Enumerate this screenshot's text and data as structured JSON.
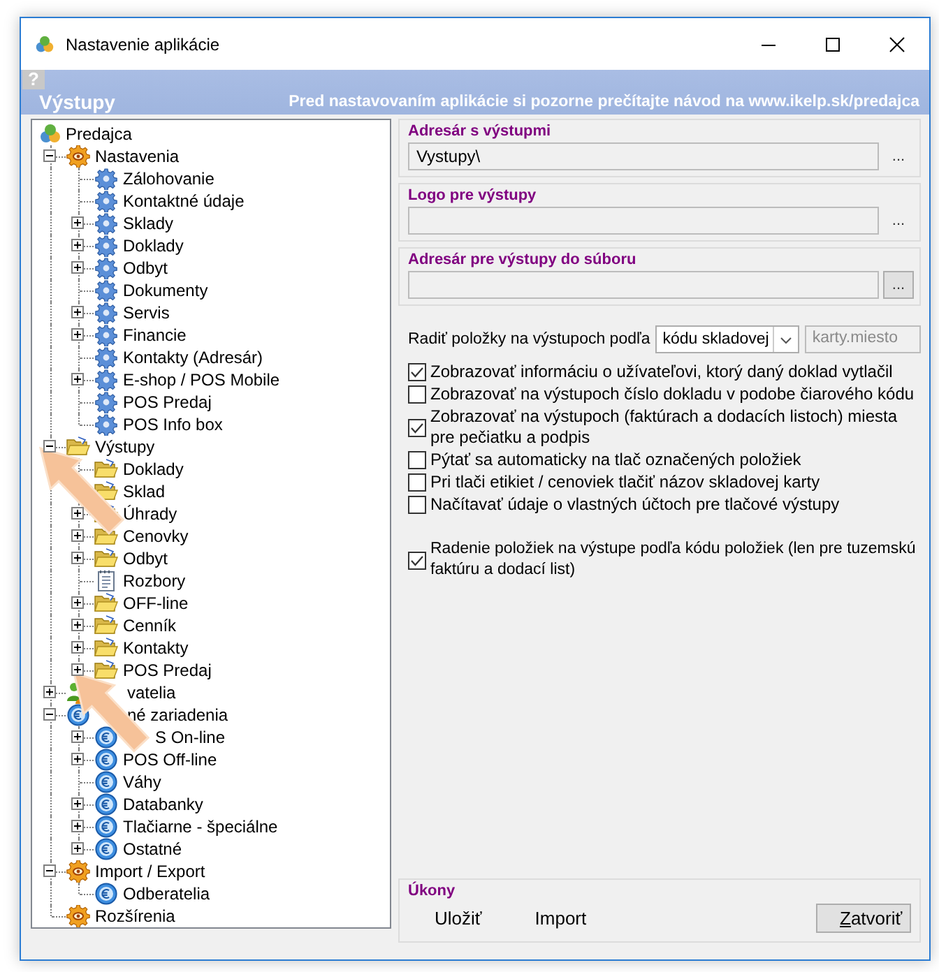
{
  "window": {
    "title": "Nastavenie aplikácie"
  },
  "help_button": "?",
  "header": {
    "title": "Výstupy",
    "notice": "Pred nastavovaním aplikácie si pozorne prečítajte návod na www.ikelp.sk/predajca"
  },
  "tree": {
    "label": "Predajca",
    "kind": "app",
    "children": [
      {
        "label": "Nastavenia",
        "kind": "cog",
        "expanded": true,
        "children": [
          {
            "label": "Zálohovanie",
            "kind": "gear"
          },
          {
            "label": "Kontaktné údaje",
            "kind": "gear"
          },
          {
            "label": "Sklady",
            "kind": "gear",
            "expanded": false
          },
          {
            "label": "Doklady",
            "kind": "gear",
            "expanded": false
          },
          {
            "label": "Odbyt",
            "kind": "gear",
            "expanded": false
          },
          {
            "label": "Dokumenty",
            "kind": "gear"
          },
          {
            "label": "Servis",
            "kind": "gear",
            "expanded": false
          },
          {
            "label": "Financie",
            "kind": "gear",
            "expanded": false
          },
          {
            "label": "Kontakty (Adresár)",
            "kind": "gear"
          },
          {
            "label": "E-shop / POS Mobile",
            "kind": "gear",
            "expanded": false
          },
          {
            "label": "POS Predaj",
            "kind": "gear"
          },
          {
            "label": "POS Info box",
            "kind": "gear"
          }
        ]
      },
      {
        "label": "Výstupy",
        "kind": "folder",
        "expanded": true,
        "children": [
          {
            "label": "Doklady",
            "kind": "folder"
          },
          {
            "label": "Sklad",
            "kind": "folder"
          },
          {
            "label": "Úhrady",
            "kind": "folder",
            "expanded": false
          },
          {
            "label": "Cenovky",
            "kind": "folder",
            "expanded": false
          },
          {
            "label": "Odbyt",
            "kind": "folder",
            "expanded": false
          },
          {
            "label": "Rozbory",
            "kind": "doc"
          },
          {
            "label": "OFF-line",
            "kind": "folder",
            "expanded": false
          },
          {
            "label": "Cenník",
            "kind": "folder",
            "expanded": false
          },
          {
            "label": "Kontakty",
            "kind": "folder",
            "expanded": false
          },
          {
            "label": "POS Predaj",
            "kind": "folder",
            "expanded": false
          }
        ]
      },
      {
        "label": "vatelia",
        "kind": "users",
        "expanded": false,
        "covered": true
      },
      {
        "label": "né zariadenia",
        "kind": "euro",
        "expanded": true,
        "covered": true,
        "children": [
          {
            "label": "S On-line",
            "kind": "euro",
            "expanded": false,
            "covered": true
          },
          {
            "label": "POS Off-line",
            "kind": "euro",
            "expanded": false
          },
          {
            "label": "Váhy",
            "kind": "euro"
          },
          {
            "label": "Databanky",
            "kind": "euro",
            "expanded": false
          },
          {
            "label": "Tlačiarne - špeciálne",
            "kind": "euro",
            "expanded": false
          },
          {
            "label": "Ostatné",
            "kind": "euro",
            "expanded": false
          }
        ]
      },
      {
        "label": "Import / Export",
        "kind": "cog",
        "expanded": true,
        "children": [
          {
            "label": "Odberatelia",
            "kind": "euro"
          }
        ]
      },
      {
        "label": "Rozšírenia",
        "kind": "cog"
      }
    ]
  },
  "path_groups": [
    {
      "legend": "Adresár s výstupmi",
      "value": "Vystupy\\",
      "button": "...",
      "button_framed": false
    },
    {
      "legend": "Logo pre výstupy",
      "button": "...",
      "button_framed": false
    },
    {
      "legend": "Adresár pre výstupy do súboru",
      "button": "...",
      "button_framed": true
    }
  ],
  "sort_by": {
    "label": "Radiť položky na výstupoch podľa",
    "value": "kódu skladovej",
    "extra_value": "karty.miesto"
  },
  "print_options": [
    {
      "label": "Zobrazovať informáciu o užívateľovi, ktorý daný doklad vytlačil",
      "checked": true
    },
    {
      "label": "Zobrazovať na výstupoch číslo dokladu v podobe čiarového kódu",
      "checked": false
    },
    {
      "label": "Zobrazovať na výstupoch (faktúrach a dodacích listoch) miesta pre pečiatku a podpis",
      "checked": true
    },
    {
      "label": "Pýtať sa automaticky na tlač označených položiek",
      "checked": false
    },
    {
      "label": "Pri tlači etikiet / cenoviek tlačiť názov skladovej karty",
      "checked": false
    },
    {
      "label": "Načítavať údaje o vlastných účtoch pre tlačové výstupy",
      "checked": false
    }
  ],
  "item_sorting": {
    "label": "Radenie položiek na výstupe podľa kódu položiek (len pre tuzemskú faktúru a dodací list)",
    "checked": true
  },
  "actions": {
    "legend": "Úkony",
    "buttons": [
      {
        "label": "Uložiť",
        "framed": false
      },
      {
        "label": "Import",
        "framed": false
      },
      {
        "label": "Zatvoriť",
        "framed": true
      }
    ]
  }
}
